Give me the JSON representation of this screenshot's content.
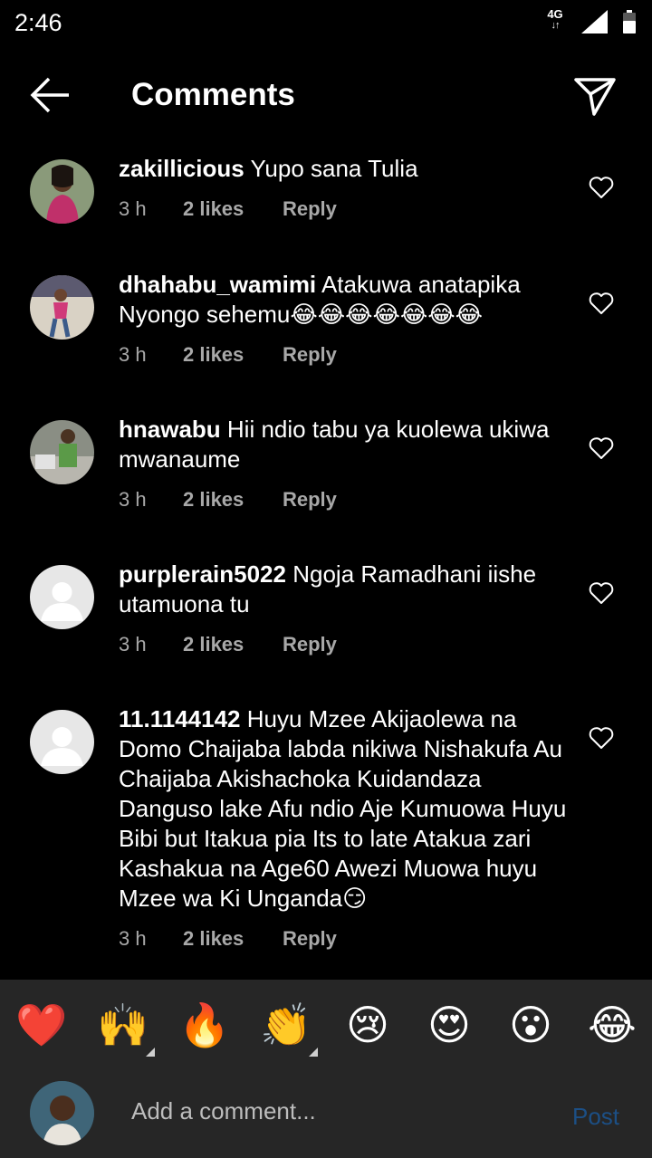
{
  "status_bar": {
    "time": "2:46",
    "network": "4G",
    "network_arrows": "↓↑"
  },
  "header": {
    "title": "Comments"
  },
  "comments": [
    {
      "username": "zakillicious",
      "text": "Yupo sana Tulia",
      "time": "3 h",
      "likes": "2 likes",
      "reply": "Reply"
    },
    {
      "username": "dhahabu_wamimi",
      "text": "Atakuwa anatapika Nyongo sehemu😂😂😂😂😂😂😂",
      "time": "3 h",
      "likes": "2 likes",
      "reply": "Reply"
    },
    {
      "username": "hnawabu",
      "text": "Hii ndio tabu ya kuolewa ukiwa mwanaume",
      "time": "3 h",
      "likes": "2 likes",
      "reply": "Reply"
    },
    {
      "username": "purplerain5022",
      "text": "Ngoja Ramadhani iishe utamuona tu",
      "time": "3 h",
      "likes": "2 likes",
      "reply": "Reply"
    },
    {
      "username": "11.1144142",
      "text": "Huyu Mzee Akijaolewa na Domo Chaijaba labda nikiwa Nishakufa Au  Chaijaba  Akishachoka Kuidandaza Danguso lake Afu ndio Aje Kumuowa Huyu  Bibi  but Itakua pia  Its to late Atakua zari Kashakua na Age60  Awezi Muowa huyu Mzee wa Ki Unganda😏",
      "time": "3 h",
      "likes": "2 likes",
      "reply": "Reply"
    }
  ],
  "emoji_bar": [
    "❤️",
    "🙌",
    "🔥",
    "👏",
    "😢",
    "😍",
    "😮",
    "😂"
  ],
  "composer": {
    "placeholder": "Add a comment...",
    "post_label": "Post"
  },
  "colors": {
    "background": "#000000",
    "panel": "#262626",
    "secondary_text": "#a8a8a8",
    "post_disabled": "#1c4f85"
  }
}
